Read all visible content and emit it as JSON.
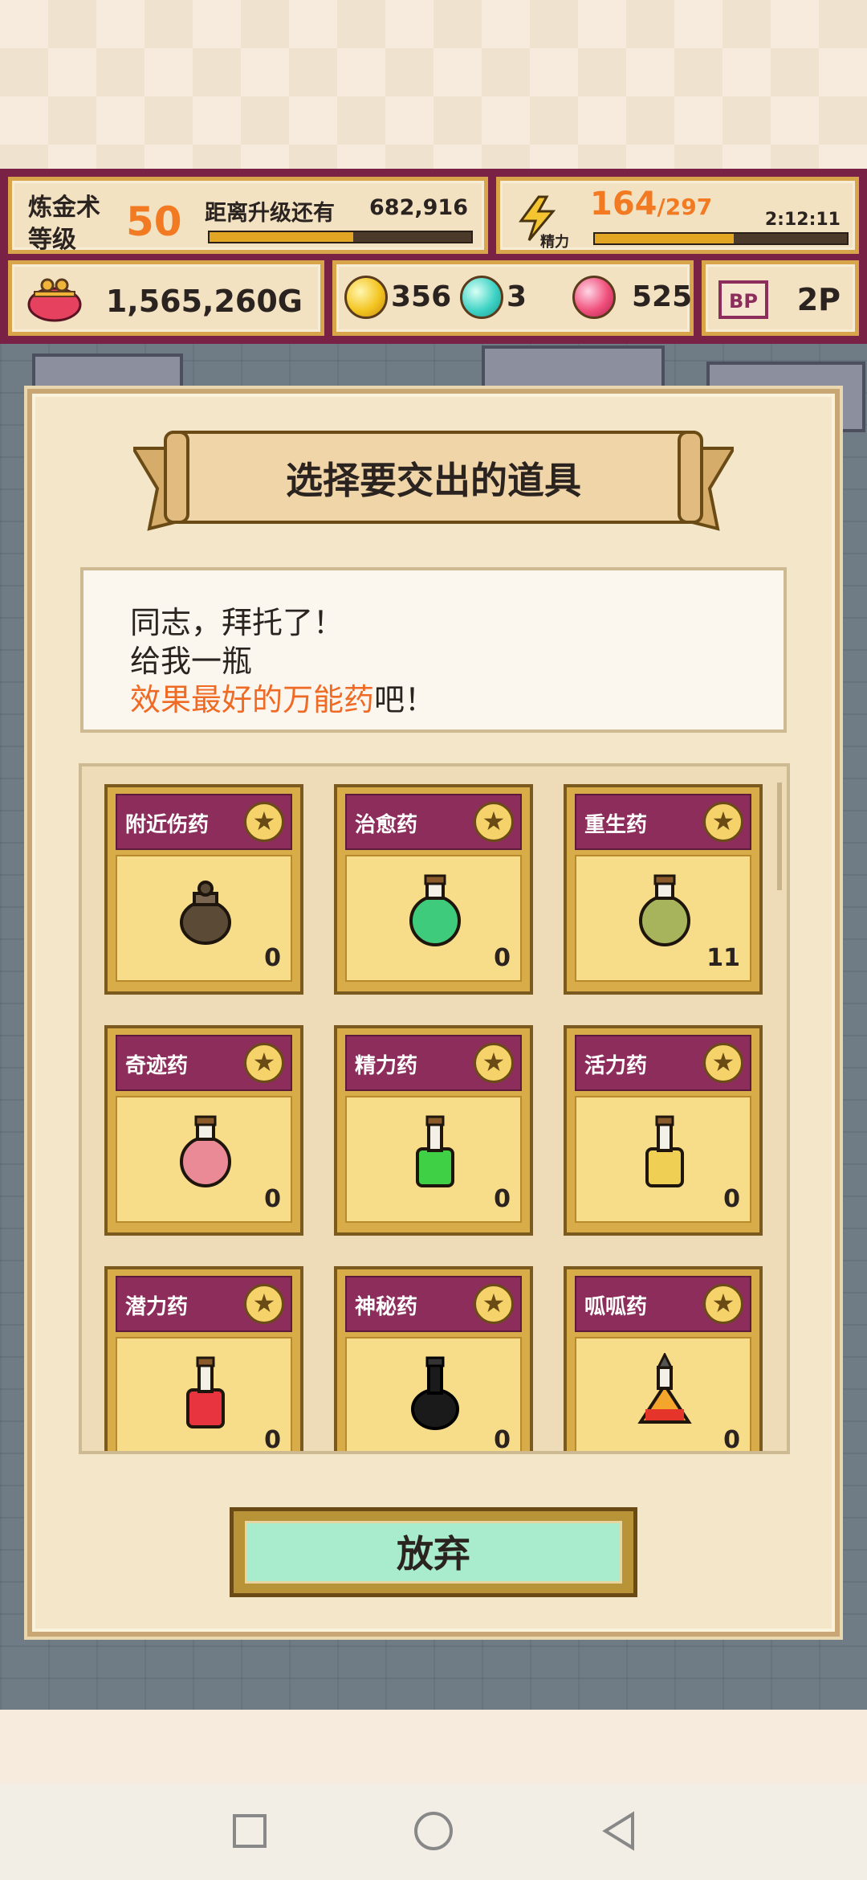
{
  "hud": {
    "level_title_line1": "炼金术",
    "level_title_line2": "等级",
    "level": "50",
    "exp_label": "距离升级还有",
    "exp_remaining": "682,916",
    "exp_progress": 0.55,
    "energy_label": "精力",
    "energy_current": "164",
    "energy_max": "/297",
    "energy_progress": 0.55,
    "energy_timer": "2:12:11",
    "money": "1,565,260G",
    "gem_yellow": "356",
    "gem_cyan": "3",
    "gem_pink": "525",
    "bp_icon_text": "BP",
    "bp": "2P"
  },
  "panel": {
    "title": "选择要交出的道具",
    "dialog_line1": "同志，拜托了！",
    "dialog_line2": "给我一瓶",
    "dialog_highlight": "效果最好的万能药",
    "dialog_suffix": "吧！"
  },
  "items": [
    {
      "name": "附近伤药",
      "count": "0",
      "icon": "pouch-icon"
    },
    {
      "name": "治愈药",
      "count": "0",
      "icon": "green-flask-icon"
    },
    {
      "name": "重生药",
      "count": "11",
      "icon": "olive-flask-icon"
    },
    {
      "name": "奇迹药",
      "count": "0",
      "icon": "pink-flask-icon"
    },
    {
      "name": "精力药",
      "count": "0",
      "icon": "green-bottle-icon"
    },
    {
      "name": "活力药",
      "count": "0",
      "icon": "yellow-bottle-icon"
    },
    {
      "name": "潜力药",
      "count": "0",
      "icon": "red-bottle-icon"
    },
    {
      "name": "神秘药",
      "count": "0",
      "icon": "black-bottle-icon"
    },
    {
      "name": "呱呱药",
      "count": "0",
      "icon": "orange-flask-icon"
    }
  ],
  "buttons": {
    "give_up": "放弃"
  },
  "colors": {
    "accent_orange": "#f17a22",
    "hud_bg": "#7a2146",
    "card_header": "#8c2d5b",
    "button_fill": "#a8ebcd"
  }
}
